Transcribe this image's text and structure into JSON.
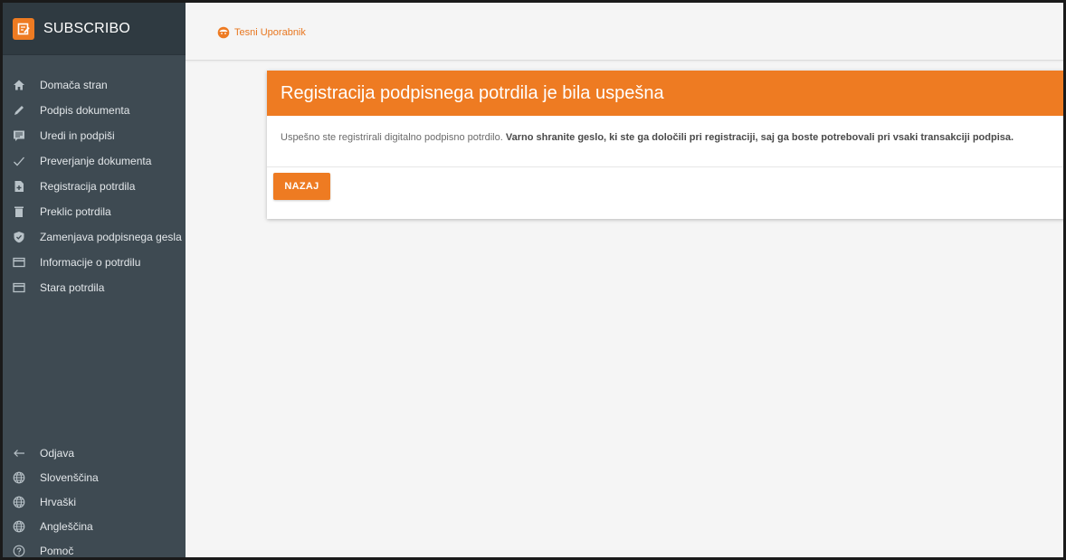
{
  "app": {
    "title": "SUBSCRIBO",
    "brand_color": "#ee7b22"
  },
  "sidebar": {
    "items": [
      {
        "label": "Domača stran",
        "icon": "home-icon"
      },
      {
        "label": "Podpis dokumenta",
        "icon": "pen-icon"
      },
      {
        "label": "Uredi in podpiši",
        "icon": "edit-list-icon"
      },
      {
        "label": "Preverjanje dokumenta",
        "icon": "check-icon"
      },
      {
        "label": "Registracija potrdila",
        "icon": "file-plus-icon"
      },
      {
        "label": "Preklic potrdila",
        "icon": "trash-icon"
      },
      {
        "label": "Zamenjava podpisnega gesla",
        "icon": "shield-icon"
      },
      {
        "label": "Informacije o potrdilu",
        "icon": "card-icon"
      },
      {
        "label": "Stara potrdila",
        "icon": "card-icon"
      }
    ],
    "bottom_items": [
      {
        "label": "Odjava",
        "icon": "arrow-left-icon"
      },
      {
        "label": "Slovenščina",
        "icon": "globe-icon"
      },
      {
        "label": "Hrvaški",
        "icon": "globe-icon"
      },
      {
        "label": "Angleščina",
        "icon": "globe-icon"
      },
      {
        "label": "Pomoč",
        "icon": "help-icon"
      }
    ]
  },
  "topbar": {
    "user_name": "Tesni Uporabnik",
    "user_icon": "user-face-icon"
  },
  "card": {
    "title": "Registracija podpisnega potrdila je bila uspešna",
    "body_plain": "Uspešno ste registrirali digitalno podpisno potrdilo. ",
    "body_bold": "Varno shranite geslo, ki ste ga določili pri registraciji, saj ga boste potrebovali pri vsaki transakciji podpisa.",
    "back_button": "NAZAJ"
  }
}
